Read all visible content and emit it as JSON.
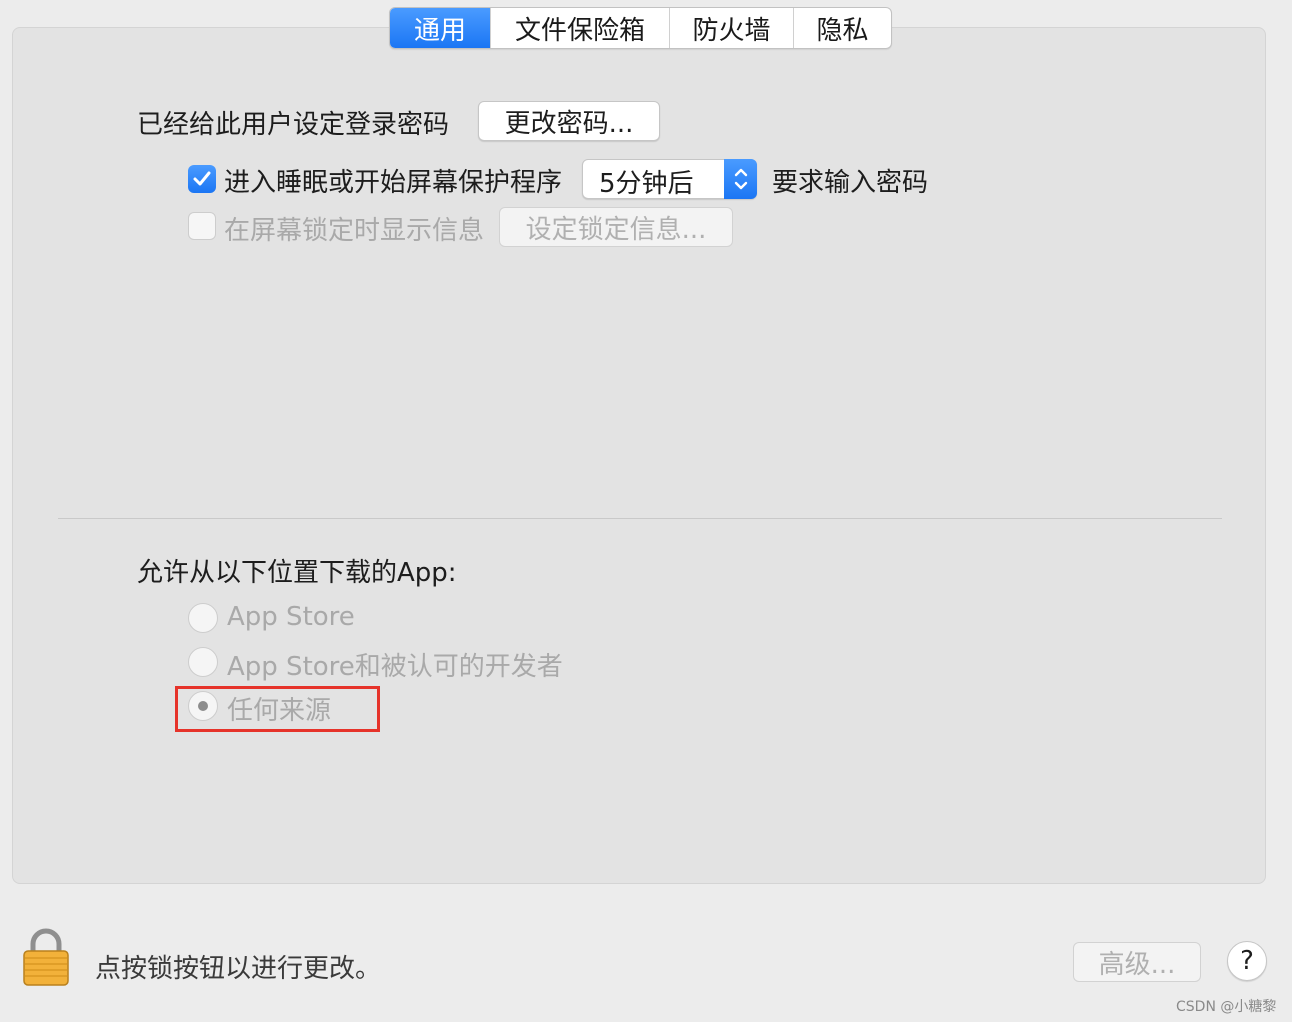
{
  "tabs": [
    {
      "label": "通用",
      "active": true
    },
    {
      "label": "文件保险箱",
      "active": false
    },
    {
      "label": "防火墙",
      "active": false
    },
    {
      "label": "隐私",
      "active": false
    }
  ],
  "general": {
    "password_set_text": "已经给此用户设定登录密码",
    "change_password_button": "更改密码...",
    "require_password": {
      "checked": true,
      "label": "进入睡眠或开始屏幕保护程序",
      "delay_value": "5分钟后",
      "suffix": "要求输入密码"
    },
    "lock_message": {
      "checked": false,
      "label": "在屏幕锁定时显示信息",
      "button": "设定锁定信息..."
    }
  },
  "downloads": {
    "heading": "允许从以下位置下载的App:",
    "options": [
      {
        "label": "App Store",
        "selected": false
      },
      {
        "label": "App Store和被认可的开发者",
        "selected": false
      },
      {
        "label": "任何来源",
        "selected": true
      }
    ]
  },
  "footer": {
    "lock_text": "点按锁按钮以进行更改。",
    "advanced_button": "高级...",
    "help_label": "?"
  },
  "watermark": "CSDN @小糖黎",
  "colors": {
    "accent": "#1b76f4",
    "highlight_box": "#e6332a",
    "panel_bg": "#e3e3e3",
    "window_bg": "#ececec"
  }
}
